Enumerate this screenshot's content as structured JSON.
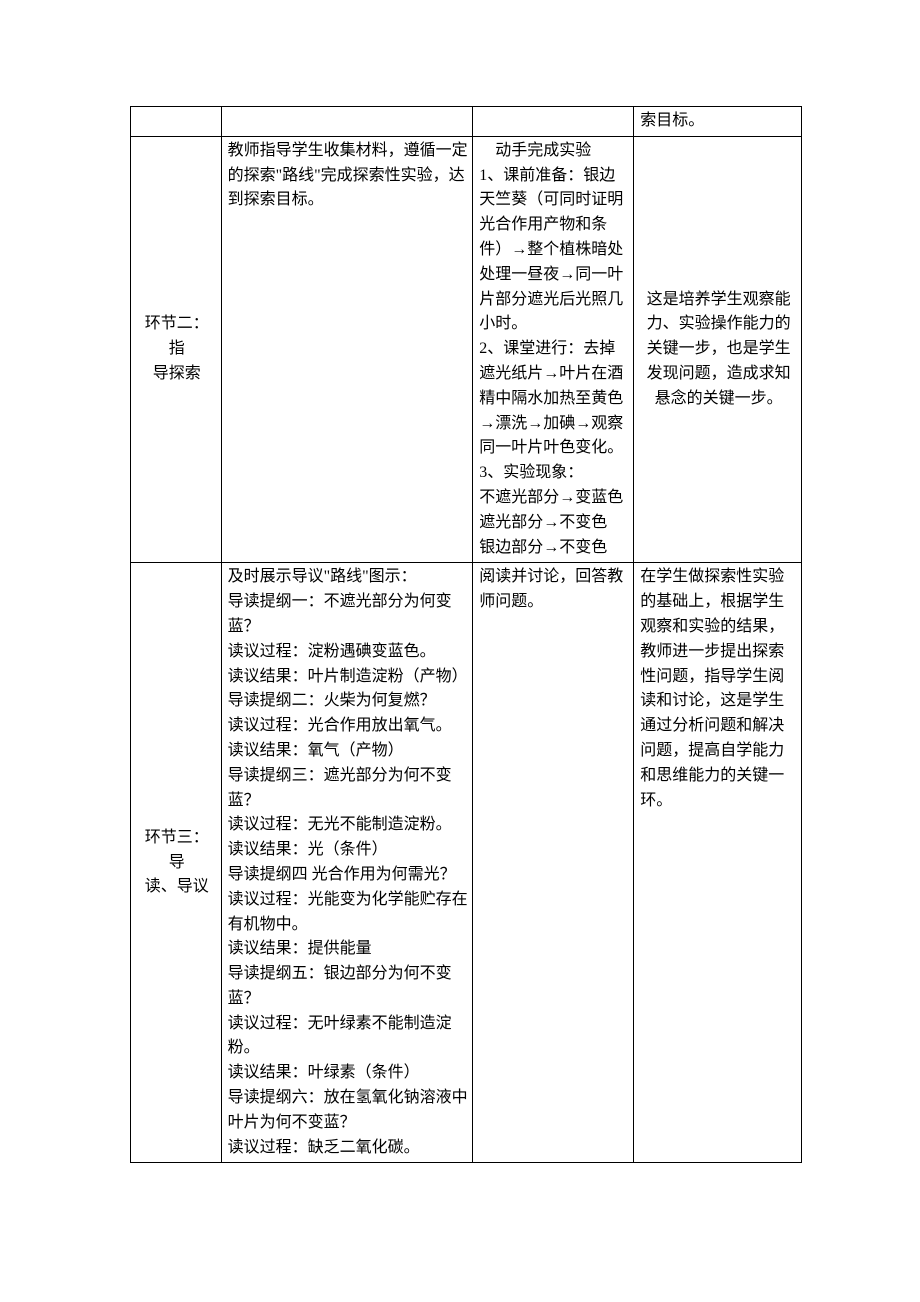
{
  "row0": {
    "c1": "",
    "c2": "",
    "c3": "",
    "c4": "索目标。"
  },
  "row1": {
    "label_a": "环节二：指",
    "label_b": "导探索",
    "col2": "教师指导学生收集材料，遵循一定的探索\"路线\"完成探索性实验，达到探索目标。",
    "col3": {
      "p0": "动手完成实验",
      "p1": "1、课前准备：银边天竺葵（可同时证明光合作用产物和条件）→整个植株暗处处理一昼夜→同一叶片部分遮光后光照几小时。",
      "p2": "2、课堂进行：去掉遮光纸片→叶片在酒精中隔水加热至黄色→漂洗→加碘→观察同一叶片叶色变化。",
      "p3": "3、实验现象：",
      "p4": "不遮光部分→变蓝色",
      "p5": "遮光部分→不变色",
      "p6": "银边部分→不变色"
    },
    "col4": "这是培养学生观察能力、实验操作能力的关键一步，也是学生发现问题，造成求知悬念的关键一步。"
  },
  "row2": {
    "label_a": "环节三：导",
    "label_b": "读、导议",
    "col2": {
      "p0": "及时展示导议\"路线\"图示：",
      "p1": "导读提纲一：不遮光部分为何变蓝？",
      "p2": "读议过程：淀粉遇碘变蓝色。",
      "p3": "读议结果：叶片制造淀粉（产物）",
      "p4": "导读提纲二：火柴为何复燃？",
      "p5": "读议过程：光合作用放出氧气。",
      "p6": "读议结果：氧气（产物）",
      "p7": "导读提纲三：遮光部分为何不变蓝？",
      "p8": "读议过程：无光不能制造淀粉。",
      "p9": "读议结果：光（条件）",
      "p10": "导读提纲四 光合作用为何需光？",
      "p11": "读议过程：光能变为化学能贮存在有机物中。",
      "p12": "读议结果：提供能量",
      "p13": "导读提纲五：银边部分为何不变蓝？",
      "p14": "读议过程：无叶绿素不能制造淀粉。",
      "p15": "读议结果：叶绿素（条件）",
      "p16": "导读提纲六：放在氢氧化钠溶液中叶片为何不变蓝？",
      "p17": "读议过程：缺乏二氧化碳。"
    },
    "col3": "阅读并讨论，回答教师问题。",
    "col4": "在学生做探索性实验的基础上，根据学生观察和实验的结果，教师进一步提出探索性问题，指导学生阅读和讨论，这是学生通过分析问题和解决问题，提高自学能力和思维能力的关键一环。"
  }
}
